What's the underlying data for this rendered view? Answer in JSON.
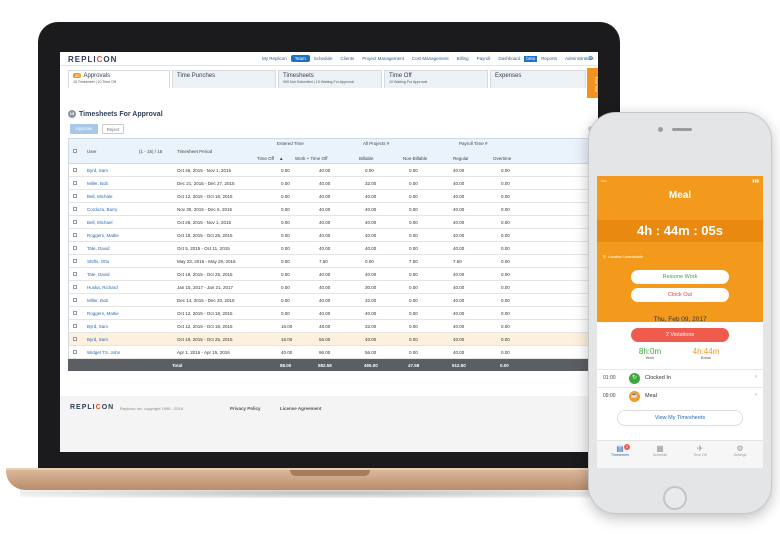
{
  "app": {
    "logo_pre": "REPLI",
    "logo_c": "C",
    "logo_post": "ON"
  },
  "nav": {
    "items": [
      "My Replicon",
      "Team",
      "Schedule",
      "Clients",
      "Project Management",
      "Cost Management",
      "Billing",
      "Payroll",
      "Dashboard",
      "Reports",
      "Administration"
    ],
    "active": "Team",
    "beta_label": "beta"
  },
  "free_trial": "Free Trial",
  "tabs": [
    {
      "name": "Approvals",
      "count": "30",
      "sub": "15 Timesheet | 10 Time Off"
    },
    {
      "name": "Time Punches",
      "sub": ""
    },
    {
      "name": "Timesheets",
      "sub": "965 Not Submitted | 15 Waiting For Approval"
    },
    {
      "name": "Time Off",
      "sub": "10 Waiting For Approval"
    },
    {
      "name": "Expenses",
      "sub": ""
    }
  ],
  "section": {
    "count": "15",
    "title": "Timesheets For Approval"
  },
  "buttons": {
    "approve": "Approve",
    "reject": "Reject"
  },
  "table": {
    "headers": {
      "user": "User",
      "range": "(1 - 15) / 15",
      "period": "Timesheet Period",
      "entered_time": "Entered Time",
      "time_off": "Time Off",
      "sort": "▲",
      "work_time_off": "Work + Time Off",
      "all_projects": "All Projects #",
      "billable": "Billable",
      "non_billable": "Non-Billable",
      "payroll": "Payroll Time #",
      "regular": "Regular",
      "overtime": "Overtime"
    },
    "rows": [
      {
        "user": "Byrd, Sam",
        "period": "Oct 26, 2015 - Nov 1, 2015",
        "time_off": "0.00",
        "work": "40.00",
        "billable": "0.00",
        "non_billable": "0.00",
        "regular": "40.00",
        "overtime": "0.00"
      },
      {
        "user": "Miller, Bob",
        "period": "Dec 21, 2015 - Dec 27, 2015",
        "time_off": "0.00",
        "work": "40.00",
        "billable": "32.00",
        "non_billable": "0.00",
        "regular": "40.00",
        "overtime": "0.00"
      },
      {
        "user": "Bell, Michale",
        "period": "Oct 12, 2015 - Oct 18, 2015",
        "time_off": "0.00",
        "work": "40.00",
        "billable": "40.00",
        "non_billable": "0.00",
        "regular": "40.00",
        "overtime": "0.00"
      },
      {
        "user": "Cordoza, Barry",
        "period": "Nov 30, 2015 - Dec 6, 2015",
        "time_off": "0.00",
        "work": "40.00",
        "billable": "40.00",
        "non_billable": "0.00",
        "regular": "40.00",
        "overtime": "0.00"
      },
      {
        "user": "Bell, Michael",
        "period": "Oct 26, 2015 - Nov 1, 2015",
        "time_off": "0.00",
        "work": "40.00",
        "billable": "40.00",
        "non_billable": "0.00",
        "regular": "40.00",
        "overtime": "0.00"
      },
      {
        "user": "Roggers, Mattie",
        "period": "Oct 19, 2015 - Oct 25, 2015",
        "time_off": "0.00",
        "work": "40.00",
        "billable": "40.00",
        "non_billable": "0.00",
        "regular": "40.00",
        "overtime": "0.00"
      },
      {
        "user": "Tate, David",
        "period": "Oct 5, 2015 - Oct 11, 2015",
        "time_off": "0.00",
        "work": "40.00",
        "billable": "40.00",
        "non_billable": "0.00",
        "regular": "40.00",
        "overtime": "0.00"
      },
      {
        "user": "Shifts, Otto",
        "period": "May 23, 2016 - May 29, 2016",
        "time_off": "0.00",
        "work": "7.50",
        "billable": "0.00",
        "non_billable": "7.50",
        "regular": "7.50",
        "overtime": "0.00"
      },
      {
        "user": "Tate, David",
        "period": "Oct 19, 2015 - Oct 25, 2015",
        "time_off": "0.00",
        "work": "40.00",
        "billable": "40.00",
        "non_billable": "0.00",
        "regular": "40.00",
        "overtime": "0.00"
      },
      {
        "user": "Huska, Richard",
        "period": "Jan 15, 2017 - Jan 21, 2017",
        "time_off": "0.00",
        "work": "40.00",
        "billable": "30.00",
        "non_billable": "0.00",
        "regular": "40.00",
        "overtime": "0.00"
      },
      {
        "user": "Miller, Bob",
        "period": "Dec 14, 2015 - Dec 20, 2015",
        "time_off": "0.00",
        "work": "40.00",
        "billable": "32.00",
        "non_billable": "0.00",
        "regular": "40.00",
        "overtime": "0.00"
      },
      {
        "user": "Roggers, Mattie",
        "period": "Oct 12, 2015 - Oct 18, 2015",
        "time_off": "0.00",
        "work": "40.00",
        "billable": "40.00",
        "non_billable": "0.00",
        "regular": "40.00",
        "overtime": "0.00"
      },
      {
        "user": "Byrd, Sam",
        "period": "Oct 12, 2015 - Oct 18, 2015",
        "time_off": "16.00",
        "work": "48.00",
        "billable": "32.00",
        "non_billable": "0.00",
        "regular": "40.00",
        "overtime": "0.00"
      },
      {
        "user": "Byrd, Sam",
        "period": "Oct 19, 2015 - Oct 25, 2015",
        "time_off": "16.00",
        "work": "56.00",
        "billable": "40.00",
        "non_billable": "0.00",
        "regular": "40.00",
        "overtime": "0.00"
      },
      {
        "user": "Widget TS, John",
        "period": "Apr 1, 2016 - Apr 15, 2016",
        "time_off": "40.00",
        "work": "96.00",
        "billable": "56.00",
        "non_billable": "0.00",
        "regular": "40.00",
        "overtime": "0.00"
      }
    ],
    "total": {
      "label": "Total",
      "time_off": "88.00",
      "work": "582.58",
      "billable": "465.00",
      "non_billable": "47.58",
      "regular": "512.50",
      "overtime": "0.00"
    }
  },
  "footer": {
    "copyright": "Replicon Inc. copyright 1996 - 2016",
    "privacy": "Privacy Policy",
    "license": "License Agreement"
  },
  "phone": {
    "status_left": "•••• ",
    "status_time": "9:41 AM",
    "status_right": "▮▮▮",
    "title": "Meal",
    "timer": "4h : 44m : 05s",
    "location": "Location Unavailable",
    "resume": "Resume Work",
    "clock_out": "Clock Out",
    "date": "Thu, Feb 09, 2017",
    "violations": "2 Violations",
    "work_value": "8h:0m",
    "work_label": "Work",
    "break_value": "4h:44m",
    "break_label": "Break",
    "entries": [
      {
        "time": "01:00",
        "label": "Clocked In",
        "color": "#3aa83a"
      },
      {
        "time": "09:00",
        "label": "Meal",
        "color": "#f39a1d"
      }
    ],
    "view_button": "View My Timesheets",
    "tabs": [
      {
        "label": "Timesheets",
        "badge": "2"
      },
      {
        "label": "Schedule"
      },
      {
        "label": "Time Off"
      },
      {
        "label": "Settings"
      }
    ]
  },
  "colors": {
    "accent": "#1e72c4",
    "orange": "#f39a1d",
    "red": "#ef5b4c",
    "green": "#3aa83a"
  }
}
